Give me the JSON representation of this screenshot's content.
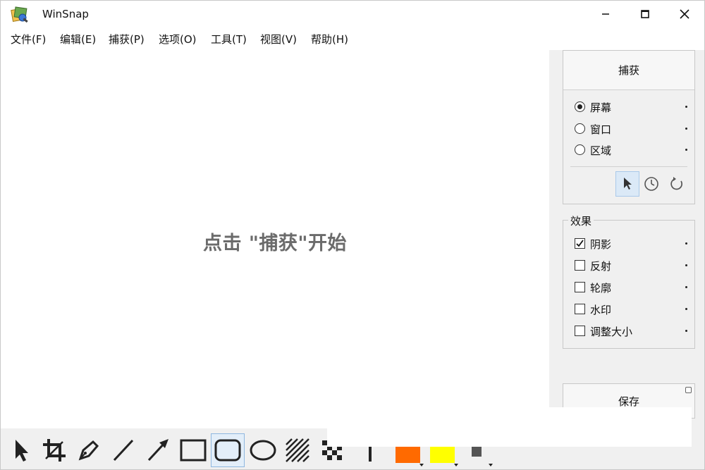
{
  "app": {
    "title": "WinSnap"
  },
  "menu": [
    "文件(F)",
    "编辑(E)",
    "捕获(P)",
    "选项(O)",
    "工具(T)",
    "视图(V)",
    "帮助(H)"
  ],
  "canvas": {
    "hint": "点击 \"捕获\"开始"
  },
  "capture": {
    "button_label": "捕获",
    "modes": [
      {
        "label": "屏幕",
        "selected": true
      },
      {
        "label": "窗口",
        "selected": false
      },
      {
        "label": "区域",
        "selected": false
      }
    ],
    "options": [
      "pointer-icon",
      "timer-icon",
      "repeat-icon"
    ]
  },
  "effects": {
    "title": "效果",
    "items": [
      {
        "label": "阴影",
        "checked": true
      },
      {
        "label": "反射",
        "checked": false
      },
      {
        "label": "轮廓",
        "checked": false
      },
      {
        "label": "水印",
        "checked": false
      },
      {
        "label": "调整大小",
        "checked": false
      }
    ]
  },
  "save": {
    "label": "保存"
  },
  "toolbar": {
    "tools": [
      "select-icon",
      "crop-icon",
      "pen-icon",
      "line-icon",
      "arrow-icon",
      "rectangle-icon",
      "rounded-rectangle-icon",
      "ellipse-icon",
      "hatch-icon",
      "pixelate-icon",
      "text-icon"
    ],
    "active_tool": "rounded-rectangle-icon",
    "colors": {
      "primary": "#ff6a00",
      "secondary": "#ffff00",
      "tertiary": "#555555"
    }
  }
}
